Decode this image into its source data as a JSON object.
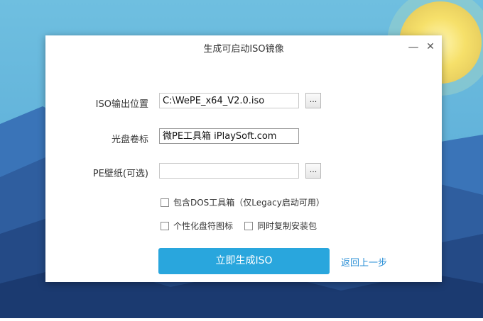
{
  "window": {
    "title": "生成可启动ISO镜像",
    "minimize_glyph": "—",
    "close_glyph": "✕"
  },
  "form": {
    "iso_output": {
      "label": "ISO输出位置",
      "value": "C:\\WePE_x64_V2.0.iso",
      "browse_label": "..."
    },
    "volume_label": {
      "label": "光盘卷标",
      "value": "微PE工具箱 iPlaySoft.com"
    },
    "wallpaper": {
      "label": "PE壁纸(可选)",
      "value": "",
      "browse_label": "..."
    }
  },
  "options": {
    "include_dos": "包含DOS工具箱（仅Legacy启动可用）",
    "personalize_icon": "个性化盘符图标",
    "copy_installer": "同时复制安装包"
  },
  "actions": {
    "generate_label": "立即生成ISO",
    "back_label": "返回上一步"
  },
  "colors": {
    "accent": "#29a6dd",
    "link": "#2a8fd6"
  }
}
